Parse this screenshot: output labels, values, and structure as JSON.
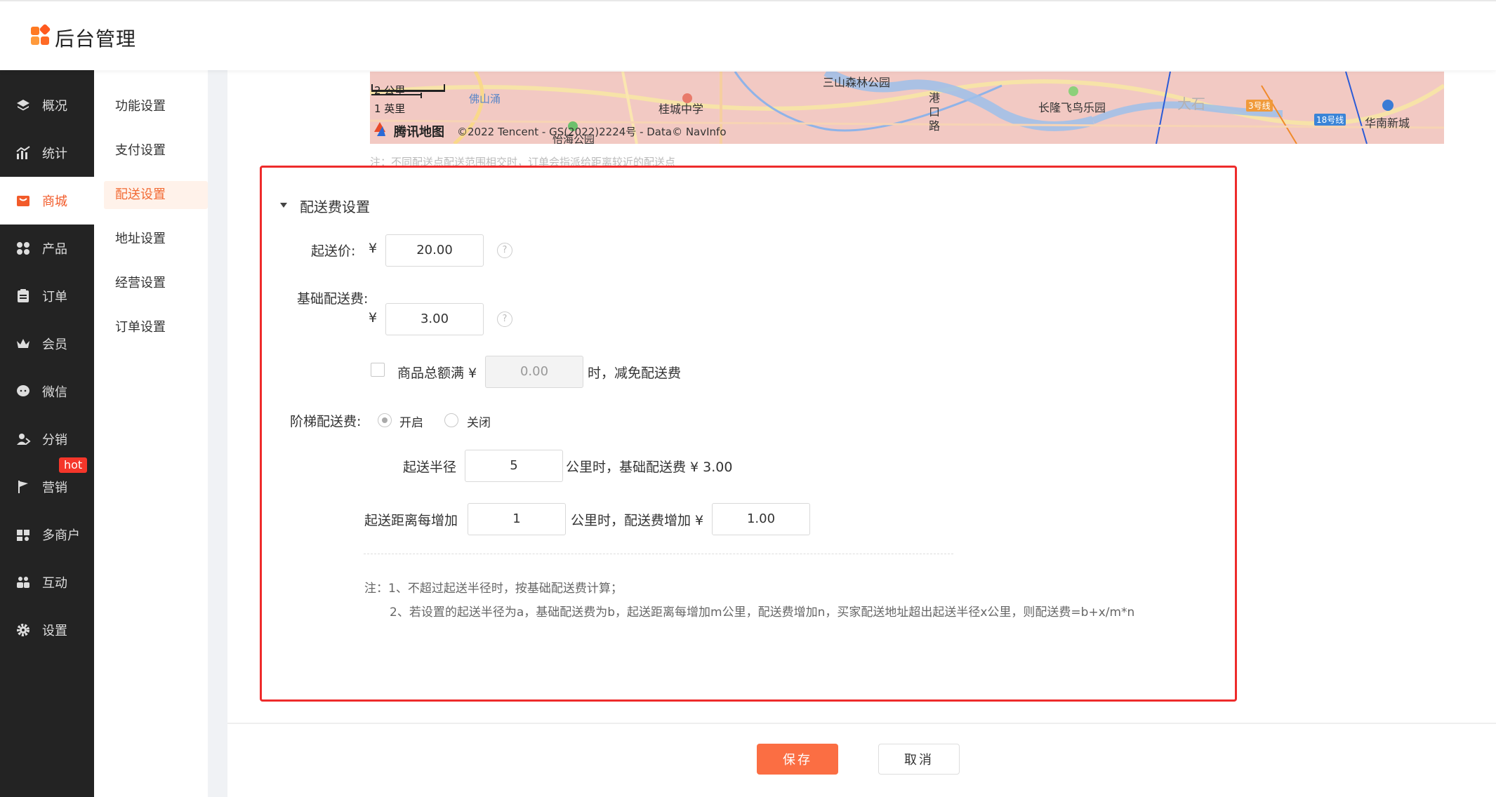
{
  "header": {
    "title": "后台管理"
  },
  "sidebar": {
    "items": [
      {
        "label": "概况",
        "icon": "layers-icon",
        "active": false
      },
      {
        "label": "统计",
        "icon": "chart-icon",
        "active": false
      },
      {
        "label": "商城",
        "icon": "shop-icon",
        "active": true
      },
      {
        "label": "产品",
        "icon": "grid-icon",
        "active": false
      },
      {
        "label": "订单",
        "icon": "clipboard-icon",
        "active": false
      },
      {
        "label": "会员",
        "icon": "crown-icon",
        "active": false
      },
      {
        "label": "微信",
        "icon": "chat-icon",
        "active": false
      },
      {
        "label": "分销",
        "icon": "user-share-icon",
        "active": false
      },
      {
        "label": "营销",
        "icon": "flag-icon",
        "active": false
      },
      {
        "label": "多商户",
        "icon": "store-icon",
        "active": false
      },
      {
        "label": "互动",
        "icon": "people-icon",
        "active": false
      },
      {
        "label": "设置",
        "icon": "gear-icon",
        "active": false
      }
    ],
    "hot_badge": "hot"
  },
  "submenu": {
    "items": [
      {
        "label": "功能设置",
        "active": false
      },
      {
        "label": "支付设置",
        "active": false
      },
      {
        "label": "配送设置",
        "active": true
      },
      {
        "label": "地址设置",
        "active": false
      },
      {
        "label": "经营设置",
        "active": false
      },
      {
        "label": "订单设置",
        "active": false
      }
    ]
  },
  "map": {
    "scale_km": "2 公里",
    "scale_mi": "1 英里",
    "brand": "腾讯地图",
    "copyright": "©2022 Tencent - GS(2022)2224号 - Data© NavInfo",
    "labels": [
      "三山森林公园",
      "桂城中学",
      "佛山涌",
      "港口路",
      "长隆飞鸟乐园",
      "大石",
      "3号线",
      "18号线",
      "华南新城",
      "怡海公园"
    ],
    "note": "注：不同配送点配送范围相交时，订单会指派给距离较近的配送点"
  },
  "fee": {
    "section_title": "配送费设置",
    "min_order_label": "起送价:",
    "currency": "¥",
    "min_order_value": "20.00",
    "base_fee_label": "基础配送费:",
    "base_fee_value": "3.00",
    "free_label": "商品总额满 ¥",
    "free_value": "0.00",
    "free_suffix": "时，减免配送费",
    "tier_label": "阶梯配送费:",
    "tier_on": "开启",
    "tier_off": "关闭",
    "radius_label": "起送半径",
    "radius_value": "5",
    "radius_suffix": "公里时，基础配送费 ¥ 3.00",
    "step_label": "起送距离每增加",
    "step_value": "1",
    "step_mid": "公里时，配送费增加 ¥",
    "step_fee_value": "1.00",
    "note1": "注：1、不超过起送半径时，按基础配送费计算；",
    "note2": "2、若设置的起送半径为a，基础配送费为b，起送距离每增加m公里，配送费增加n，买家配送地址超出起送半径x公里，则配送费=b+x/m*n"
  },
  "footer": {
    "save": "保存",
    "cancel": "取消"
  },
  "colors": {
    "accent": "#fb6e43",
    "sidebar_bg": "#232323",
    "highlight_border": "#ee2b2b"
  }
}
